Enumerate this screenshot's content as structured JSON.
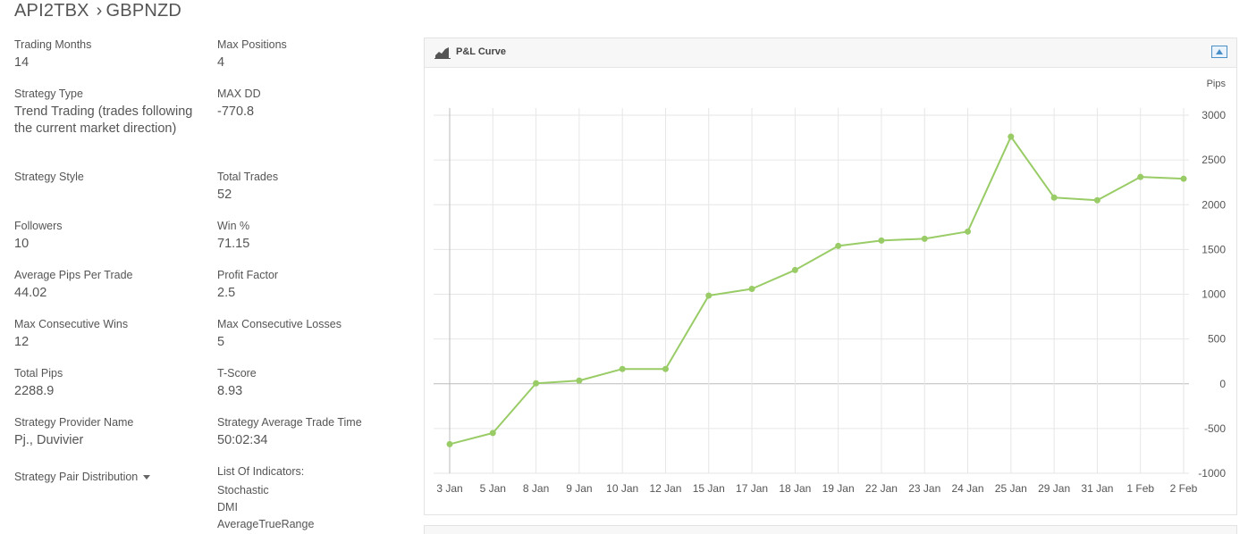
{
  "header": {
    "strategy_name": "API2TBX",
    "separator": "›",
    "pair": "GBPNZD"
  },
  "stats_left": [
    {
      "label": "Trading Months",
      "value": "14"
    },
    {
      "label": "Strategy Type",
      "value": "Trend Trading (trades following the current market direction)"
    },
    {
      "label": "Strategy Style",
      "value": ""
    },
    {
      "label": "Followers",
      "value": "10"
    },
    {
      "label": "Average Pips Per Trade",
      "value": "44.02"
    },
    {
      "label": "Max Consecutive Wins",
      "value": "12"
    },
    {
      "label": "Total Pips",
      "value": "2288.9"
    },
    {
      "label": "Strategy Provider Name",
      "value": "Pj., Duvivier"
    }
  ],
  "stats_right": [
    {
      "label": "Max Positions",
      "value": "4"
    },
    {
      "label": "MAX DD",
      "value": "-770.8"
    },
    {
      "label": "Total Trades",
      "value": "52"
    },
    {
      "label": "Win %",
      "value": "71.15"
    },
    {
      "label": "Profit Factor",
      "value": "2.5"
    },
    {
      "label": "Max Consecutive Losses",
      "value": "5"
    },
    {
      "label": "T-Score",
      "value": "8.93"
    },
    {
      "label": "Strategy Average Trade Time",
      "value": "50:02:34"
    }
  ],
  "pair_distribution": {
    "label": "Strategy Pair Distribution"
  },
  "indicators": {
    "label": "List Of Indicators:",
    "items": [
      "Stochastic",
      "DMI",
      "AverageTrueRange"
    ]
  },
  "panel": {
    "title": "P&L Curve",
    "title_icon": "area-chart-icon",
    "button_icon": "collapse-toggle-icon"
  },
  "chart_data": {
    "type": "line",
    "ylabel": "Pips",
    "y_axis_side": "right",
    "ylim": [
      -1000,
      3000
    ],
    "yticks": [
      -1000,
      -500,
      0,
      500,
      1000,
      1500,
      2000,
      2500,
      3000
    ],
    "grid": true,
    "line_color": "#99cc66",
    "categories": [
      "3 Jan",
      "5 Jan",
      "8 Jan",
      "9 Jan",
      "10 Jan",
      "12 Jan",
      "15 Jan",
      "17 Jan",
      "18 Jan",
      "19 Jan",
      "22 Jan",
      "23 Jan",
      "24 Jan",
      "25 Jan",
      "29 Jan",
      "31 Jan",
      "1 Feb",
      "2 Feb"
    ],
    "series": [
      {
        "values": [
          -675,
          -550,
          5,
          35,
          165,
          165,
          985,
          1060,
          1270,
          1540,
          1600,
          1620,
          1700,
          2760,
          2080,
          2050,
          2310,
          2290
        ]
      }
    ]
  }
}
